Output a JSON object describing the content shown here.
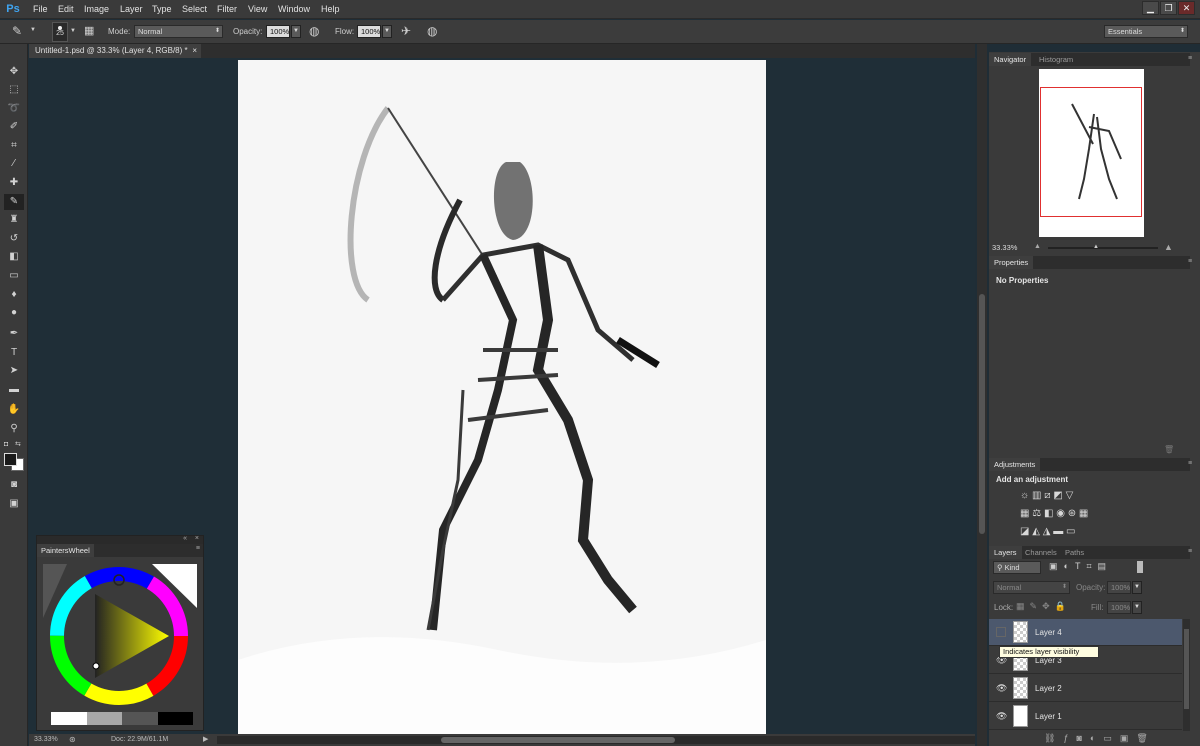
{
  "app": {
    "logo": "Ps"
  },
  "menu": [
    "File",
    "Edit",
    "Image",
    "Layer",
    "Type",
    "Select",
    "Filter",
    "View",
    "Window",
    "Help"
  ],
  "window_buttons": [
    "▁",
    "❐",
    "✕"
  ],
  "options": {
    "brush_size": "25",
    "mode_label": "Mode:",
    "mode_value": "Normal",
    "opacity_label": "Opacity:",
    "opacity_value": "100%",
    "flow_label": "Flow:",
    "flow_value": "100%",
    "workspace": "Essentials"
  },
  "document": {
    "tab_title": "Untitled-1.psd @ 33.3% (Layer 4, RGB/8) *",
    "tab_close": "×"
  },
  "status": {
    "zoom": "33.33%",
    "doc": "Doc: 22.9M/61.1M"
  },
  "navigator": {
    "tabs": [
      "Navigator",
      "Histogram"
    ],
    "zoom": "33.33%"
  },
  "properties": {
    "tab": "Properties",
    "text": "No Properties"
  },
  "adjustments": {
    "tab": "Adjustments",
    "title": "Add an adjustment"
  },
  "layers_panel": {
    "tabs": [
      "Layers",
      "Channels",
      "Paths"
    ],
    "kind": "Kind",
    "blend": "Normal",
    "opacity_label": "Opacity:",
    "opacity_value": "100%",
    "lock_label": "Lock:",
    "fill_label": "Fill:",
    "fill_value": "100%",
    "layers": [
      {
        "name": "Layer 4",
        "selected": true
      },
      {
        "name": "Layer 3",
        "selected": false
      },
      {
        "name": "Layer 2",
        "selected": false
      },
      {
        "name": "Layer 1",
        "selected": false
      }
    ],
    "tooltip": "Indicates layer visibility"
  },
  "painters_wheel": {
    "title": "PaintersWheel"
  },
  "colors": {
    "accent": "#3fa4f0",
    "selected_layer": "#4c586d",
    "canvas_bg": "#1f2e37"
  }
}
